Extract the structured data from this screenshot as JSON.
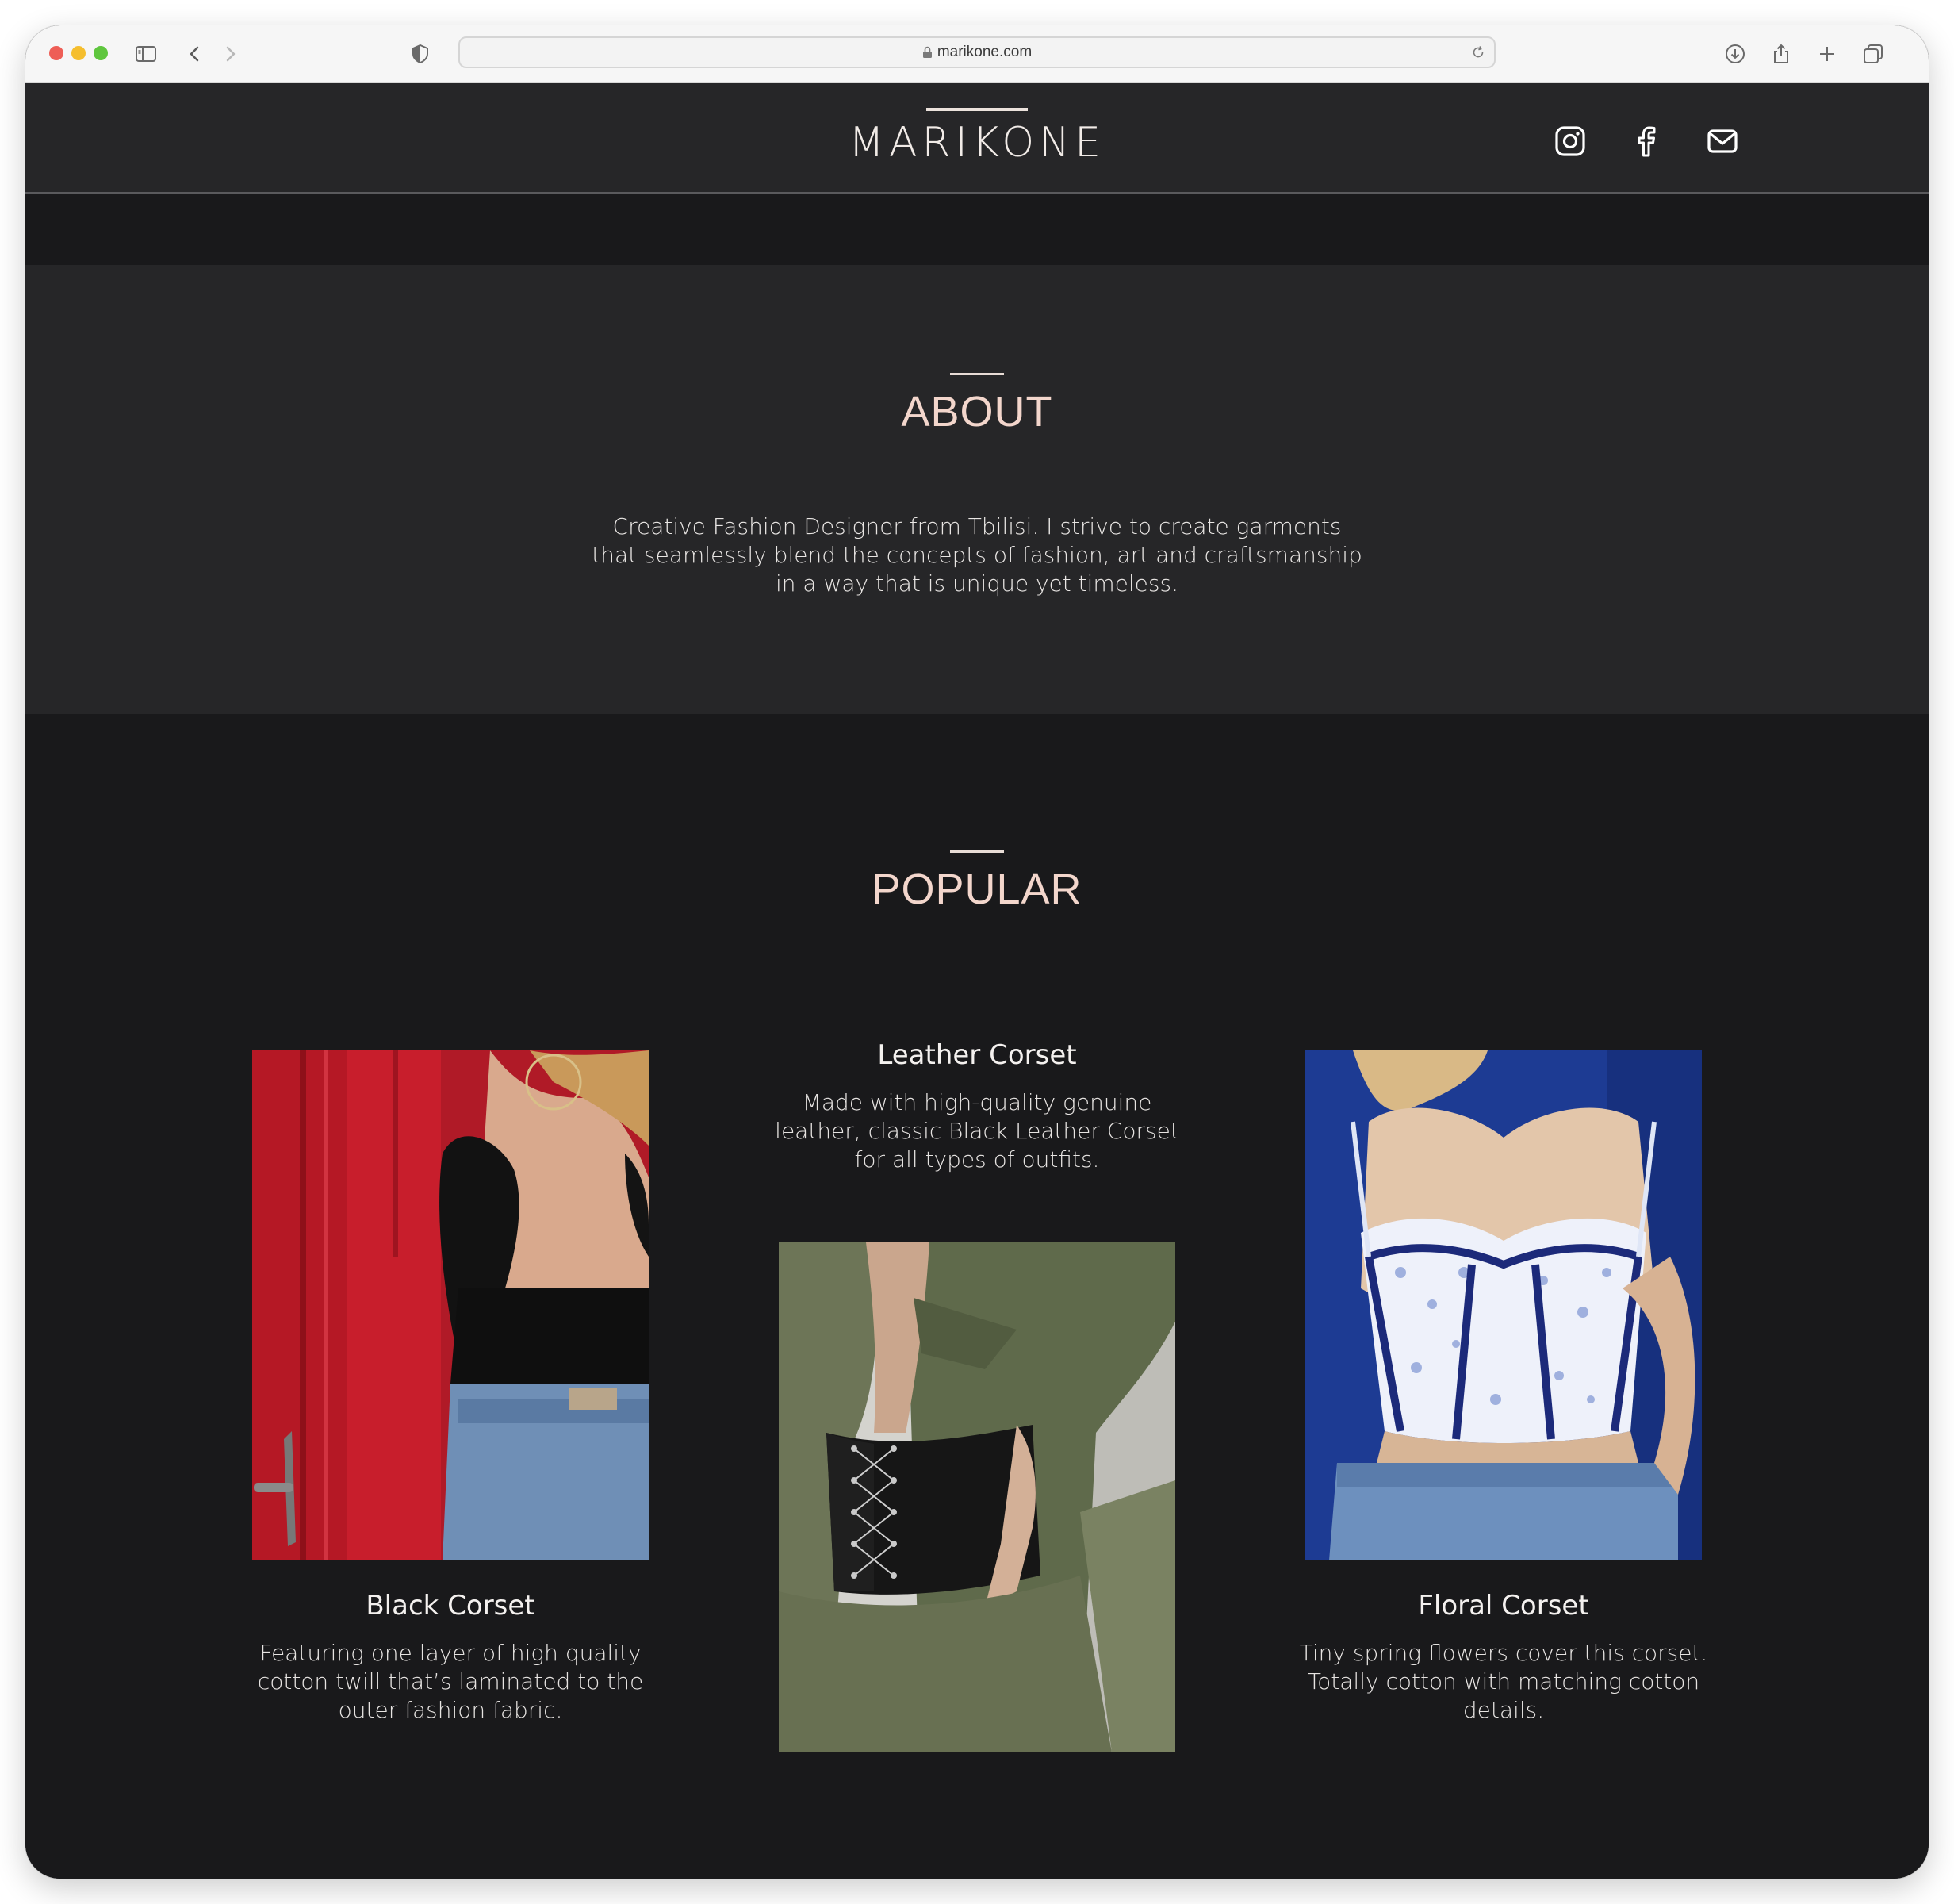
{
  "browser": {
    "url": "marikone.com",
    "icons": [
      "sidebar-icon",
      "back-icon",
      "forward-icon",
      "shield-icon",
      "lock-icon",
      "reload-icon",
      "download-icon",
      "share-icon",
      "new-tab-icon",
      "tabs-overview-icon"
    ]
  },
  "header": {
    "logo": "MARIKONE",
    "social_icons": [
      "instagram-icon",
      "facebook-icon",
      "mail-icon"
    ]
  },
  "about": {
    "title": "ABOUT",
    "text_lines": [
      "Creative Fashion Designer from Tbilisi. I strive to create garments",
      "that seamlessly blend the concepts of fashion, art and craftsmanship",
      "in a way that is unique yet timeless."
    ]
  },
  "popular": {
    "title": "POPULAR",
    "products": [
      {
        "name": "Black Corset",
        "desc_lines": [
          "Featuring one layer of high quality",
          "cotton twill that’s laminated to the",
          "outer fashion fabric."
        ]
      },
      {
        "name": "Leather Corset",
        "desc_lines": [
          "Made with high-quality genuine",
          "leather, classic Black Leather Corset",
          "for all types of outfits."
        ]
      },
      {
        "name": "Floral Corset",
        "desc_lines": [
          "Tiny spring flowers cover this corset.",
          "Totally cotton with matching cotton",
          "details."
        ]
      }
    ]
  },
  "colors": {
    "page_bg": "#19191b",
    "panel_bg": "#262628",
    "title_accent": "#f3d6cc",
    "text": "#e9e6e4"
  }
}
